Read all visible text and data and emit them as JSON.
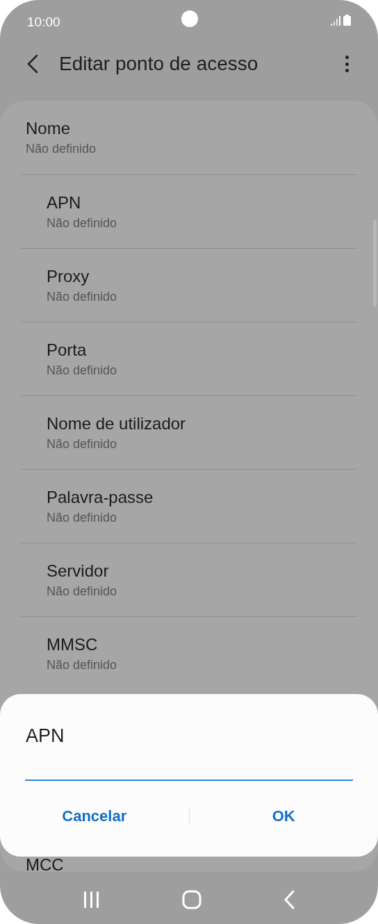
{
  "status_bar": {
    "time": "10:00"
  },
  "header": {
    "title": "Editar ponto de acesso"
  },
  "settings": [
    {
      "label": "Nome",
      "value": "Não definido"
    },
    {
      "label": "APN",
      "value": "Não definido"
    },
    {
      "label": "Proxy",
      "value": "Não definido"
    },
    {
      "label": "Porta",
      "value": "Não definido"
    },
    {
      "label": "Nome de utilizador",
      "value": "Não definido"
    },
    {
      "label": "Palavra-passe",
      "value": "Não definido"
    },
    {
      "label": "Servidor",
      "value": "Não definido"
    },
    {
      "label": "MMSC",
      "value": "Não definido"
    }
  ],
  "partial_setting": {
    "label": "MCC"
  },
  "dialog": {
    "title": "APN",
    "buttons": [
      "Cancelar",
      "OK"
    ]
  }
}
